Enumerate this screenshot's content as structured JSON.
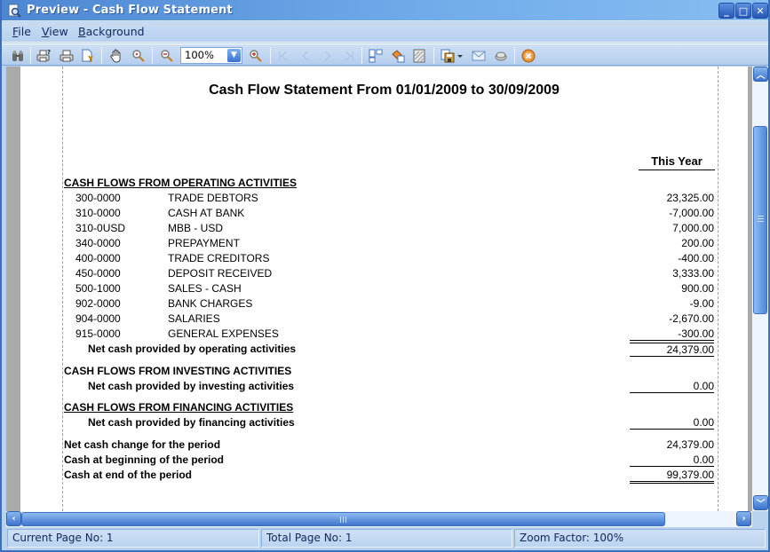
{
  "window": {
    "title": "Preview - Cash Flow Statement",
    "controls": {
      "minimize": "_",
      "maximize": "□",
      "close": "✕"
    }
  },
  "menu": [
    {
      "label": "File",
      "accel": "F",
      "rest": "ile"
    },
    {
      "label": "View",
      "accel": "V",
      "rest": "iew"
    },
    {
      "label": "Background",
      "accel": "B",
      "rest": "ackground"
    }
  ],
  "toolbar": {
    "buttons": [
      "find-icon",
      "print-setup-icon",
      "print-icon",
      "page-setup-icon",
      "hand-tool-icon",
      "zoom-tool-icon",
      "zoom-out-icon",
      "zoom-in-icon",
      "first-page-icon",
      "previous-page-icon",
      "next-page-icon",
      "last-page-icon",
      "multiple-pages-icon",
      "fill-color-icon",
      "watermark-icon",
      "save-icon",
      "save-dropdown-icon",
      "email-icon",
      "export-icon",
      "close-preview-icon"
    ],
    "zoom_value": "100%"
  },
  "report": {
    "title": "Cash Flow Statement From 01/01/2009 to 30/09/2009",
    "column_header": "This Year",
    "operating": {
      "heading": "CASH FLOWS FROM OPERATING ACTIVITIES",
      "rows": [
        {
          "code": "300-0000",
          "name": "TRADE DEBTORS",
          "amount": "23,325.00"
        },
        {
          "code": "310-0000",
          "name": "CASH AT BANK",
          "amount": "-7,000.00"
        },
        {
          "code": "310-0USD",
          "name": "MBB - USD",
          "amount": "7,000.00"
        },
        {
          "code": "340-0000",
          "name": "PREPAYMENT",
          "amount": "200.00"
        },
        {
          "code": "400-0000",
          "name": "TRADE CREDITORS",
          "amount": "-400.00"
        },
        {
          "code": "450-0000",
          "name": "DEPOSIT RECEIVED",
          "amount": "3,333.00"
        },
        {
          "code": "500-1000",
          "name": "SALES - CASH",
          "amount": "900.00"
        },
        {
          "code": "902-0000",
          "name": "BANK CHARGES",
          "amount": "-9.00"
        },
        {
          "code": "904-0000",
          "name": "SALARIES",
          "amount": "-2,670.00"
        },
        {
          "code": "915-0000",
          "name": "GENERAL EXPENSES",
          "amount": "-300.00"
        }
      ],
      "net_label": "Net cash provided by operating activities",
      "net_amount": "24,379.00"
    },
    "investing": {
      "heading": "CASH FLOWS FROM INVESTING ACTIVITIES",
      "net_label": "Net cash provided by investing activities",
      "net_amount": "0.00"
    },
    "financing": {
      "heading": "CASH FLOWS FROM FINANCING ACTIVITIES",
      "net_label": "Net cash provided by financing activities",
      "net_amount": "0.00"
    },
    "summary": [
      {
        "label": "Net cash change for the period",
        "amount": "24,379.00"
      },
      {
        "label": "Cash at beginning of the period",
        "amount": "0.00"
      },
      {
        "label": "Cash at end of the period",
        "amount": "99,379.00"
      }
    ]
  },
  "status": {
    "current_page": "Current Page No: 1",
    "total_pages": "Total Page No: 1",
    "zoom_factor": "Zoom Factor: 100%"
  }
}
